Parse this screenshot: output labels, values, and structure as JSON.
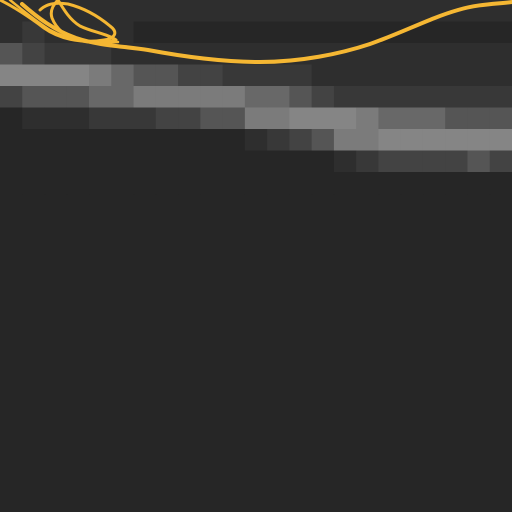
{
  "canvas": {
    "background": "#262626",
    "stroke_color": "#f5b733",
    "mosaic_palette": [
      "#262626",
      "#2e2e2e",
      "#383838",
      "#434343",
      "#555555",
      "#686868",
      "#7b7b7b",
      "#858585"
    ]
  },
  "icons": {
    "brush_cursor": "brush-stroke-icon"
  }
}
